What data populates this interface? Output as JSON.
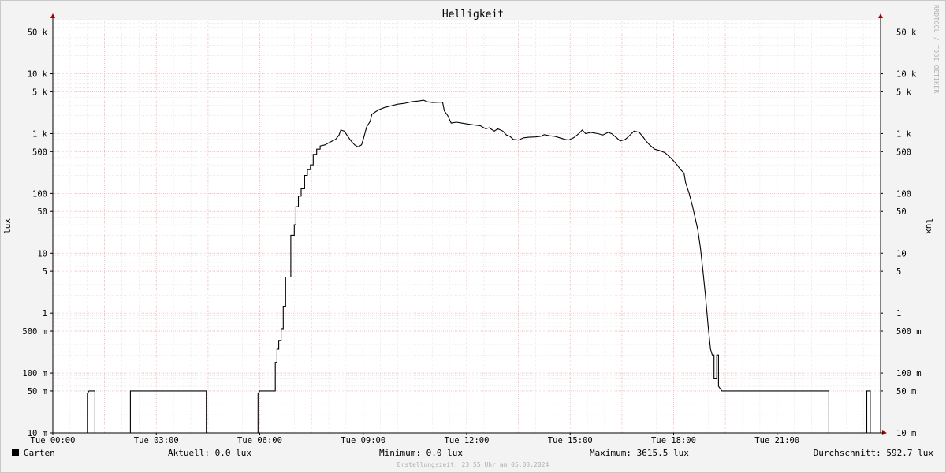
{
  "chart_data": {
    "type": "line",
    "title": "Helligkeit",
    "ylabel": "lux",
    "yscale": "log",
    "ylim": [
      0.01,
      80000
    ],
    "xlim": [
      0,
      24
    ],
    "grid": true,
    "y_ticks": [
      {
        "v": 0.01,
        "label": "10 m"
      },
      {
        "v": 0.05,
        "label": "50 m"
      },
      {
        "v": 0.1,
        "label": "100 m"
      },
      {
        "v": 0.5,
        "label": "500 m"
      },
      {
        "v": 1,
        "label": "1"
      },
      {
        "v": 5,
        "label": "5"
      },
      {
        "v": 10,
        "label": "10"
      },
      {
        "v": 50,
        "label": "50"
      },
      {
        "v": 100,
        "label": "100"
      },
      {
        "v": 500,
        "label": "500"
      },
      {
        "v": 1000,
        "label": "1 k"
      },
      {
        "v": 5000,
        "label": "5 k"
      },
      {
        "v": 10000,
        "label": "10 k"
      },
      {
        "v": 50000,
        "label": "50 k"
      }
    ],
    "x_ticks": [
      {
        "v": 0,
        "label": "Tue 00:00"
      },
      {
        "v": 3,
        "label": "Tue 03:00"
      },
      {
        "v": 6,
        "label": "Tue 06:00"
      },
      {
        "v": 9,
        "label": "Tue 09:00"
      },
      {
        "v": 12,
        "label": "Tue 12:00"
      },
      {
        "v": 15,
        "label": "Tue 15:00"
      },
      {
        "v": 18,
        "label": "Tue 18:00"
      },
      {
        "v": 21,
        "label": "Tue 21:00"
      }
    ],
    "series": [
      {
        "name": "Garten",
        "color": "#000000",
        "points": [
          [
            0,
            0.01
          ],
          [
            1.0,
            0.01
          ],
          [
            1.0,
            0.045
          ],
          [
            1.05,
            0.05
          ],
          [
            1.22,
            0.05
          ],
          [
            1.22,
            0.01
          ],
          [
            2.25,
            0.01
          ],
          [
            2.25,
            0.05
          ],
          [
            4.45,
            0.05
          ],
          [
            4.45,
            0.01
          ],
          [
            5.95,
            0.01
          ],
          [
            5.95,
            0.045
          ],
          [
            6.0,
            0.05
          ],
          [
            6.45,
            0.05
          ],
          [
            6.45,
            0.15
          ],
          [
            6.5,
            0.15
          ],
          [
            6.5,
            0.25
          ],
          [
            6.55,
            0.25
          ],
          [
            6.55,
            0.35
          ],
          [
            6.62,
            0.35
          ],
          [
            6.62,
            0.55
          ],
          [
            6.68,
            0.55
          ],
          [
            6.68,
            1.3
          ],
          [
            6.75,
            1.3
          ],
          [
            6.75,
            4
          ],
          [
            6.9,
            4
          ],
          [
            6.9,
            20
          ],
          [
            7.0,
            20
          ],
          [
            7.0,
            30
          ],
          [
            7.05,
            30
          ],
          [
            7.05,
            60
          ],
          [
            7.12,
            60
          ],
          [
            7.12,
            90
          ],
          [
            7.2,
            90
          ],
          [
            7.2,
            120
          ],
          [
            7.3,
            120
          ],
          [
            7.3,
            200
          ],
          [
            7.38,
            200
          ],
          [
            7.38,
            250
          ],
          [
            7.47,
            250
          ],
          [
            7.47,
            300
          ],
          [
            7.55,
            300
          ],
          [
            7.55,
            450
          ],
          [
            7.65,
            450
          ],
          [
            7.65,
            550
          ],
          [
            7.75,
            550
          ],
          [
            7.75,
            620
          ],
          [
            7.9,
            650
          ],
          [
            8.0,
            700
          ],
          [
            8.1,
            750
          ],
          [
            8.2,
            800
          ],
          [
            8.3,
            950
          ],
          [
            8.35,
            1150
          ],
          [
            8.45,
            1100
          ],
          [
            8.55,
            900
          ],
          [
            8.65,
            750
          ],
          [
            8.75,
            650
          ],
          [
            8.85,
            600
          ],
          [
            8.95,
            650
          ],
          [
            9.0,
            800
          ],
          [
            9.1,
            1300
          ],
          [
            9.2,
            1600
          ],
          [
            9.25,
            2100
          ],
          [
            9.35,
            2300
          ],
          [
            9.45,
            2500
          ],
          [
            9.6,
            2700
          ],
          [
            9.8,
            2900
          ],
          [
            10.0,
            3100
          ],
          [
            10.2,
            3200
          ],
          [
            10.4,
            3400
          ],
          [
            10.6,
            3500
          ],
          [
            10.75,
            3615.5
          ],
          [
            10.85,
            3400
          ],
          [
            11.0,
            3300
          ],
          [
            11.3,
            3350
          ],
          [
            11.35,
            2400
          ],
          [
            11.45,
            2000
          ],
          [
            11.55,
            1500
          ],
          [
            11.7,
            1550
          ],
          [
            11.85,
            1500
          ],
          [
            12.0,
            1450
          ],
          [
            12.2,
            1400
          ],
          [
            12.4,
            1350
          ],
          [
            12.55,
            1200
          ],
          [
            12.65,
            1250
          ],
          [
            12.8,
            1100
          ],
          [
            12.9,
            1200
          ],
          [
            13.05,
            1100
          ],
          [
            13.15,
            950
          ],
          [
            13.25,
            900
          ],
          [
            13.35,
            800
          ],
          [
            13.5,
            780
          ],
          [
            13.65,
            850
          ],
          [
            13.8,
            870
          ],
          [
            14.0,
            880
          ],
          [
            14.15,
            900
          ],
          [
            14.25,
            960
          ],
          [
            14.4,
            920
          ],
          [
            14.55,
            900
          ],
          [
            14.7,
            850
          ],
          [
            14.85,
            800
          ],
          [
            14.95,
            780
          ],
          [
            15.1,
            850
          ],
          [
            15.25,
            1000
          ],
          [
            15.35,
            1150
          ],
          [
            15.45,
            1000
          ],
          [
            15.6,
            1050
          ],
          [
            15.8,
            1000
          ],
          [
            15.95,
            950
          ],
          [
            16.1,
            1050
          ],
          [
            16.2,
            1000
          ],
          [
            16.35,
            850
          ],
          [
            16.45,
            750
          ],
          [
            16.6,
            800
          ],
          [
            16.7,
            900
          ],
          [
            16.85,
            1100
          ],
          [
            17.0,
            1050
          ],
          [
            17.1,
            900
          ],
          [
            17.2,
            750
          ],
          [
            17.3,
            650
          ],
          [
            17.45,
            550
          ],
          [
            17.6,
            520
          ],
          [
            17.75,
            480
          ],
          [
            17.9,
            400
          ],
          [
            18.0,
            350
          ],
          [
            18.1,
            300
          ],
          [
            18.2,
            250
          ],
          [
            18.3,
            220
          ],
          [
            18.35,
            150
          ],
          [
            18.45,
            100
          ],
          [
            18.55,
            60
          ],
          [
            18.62,
            40
          ],
          [
            18.7,
            25
          ],
          [
            18.78,
            12
          ],
          [
            18.85,
            5
          ],
          [
            18.92,
            2
          ],
          [
            19.0,
            0.6
          ],
          [
            19.07,
            0.25
          ],
          [
            19.12,
            0.2
          ],
          [
            19.17,
            0.2
          ],
          [
            19.17,
            0.08
          ],
          [
            19.25,
            0.08
          ],
          [
            19.25,
            0.2
          ],
          [
            19.3,
            0.2
          ],
          [
            19.3,
            0.06
          ],
          [
            19.4,
            0.05
          ],
          [
            22.5,
            0.05
          ],
          [
            22.5,
            0.01
          ],
          [
            23.6,
            0.01
          ],
          [
            23.6,
            0.05
          ],
          [
            23.7,
            0.05
          ],
          [
            23.7,
            0.01
          ],
          [
            24,
            0.01
          ]
        ]
      }
    ]
  },
  "axis_label_right": "lux",
  "watermark": "RRDTOOL / TOBI OETIKER",
  "legend": {
    "series_name": "Garten",
    "current": "Aktuell:   0.0 lux",
    "minimum": "Minimum:   0.0 lux",
    "maximum": "Maximum: 3615.5 lux",
    "average": "Durchschnitt: 592.7 lux"
  },
  "footer": "Erstellungszeit: 23:55 Uhr am 05.03.2024"
}
